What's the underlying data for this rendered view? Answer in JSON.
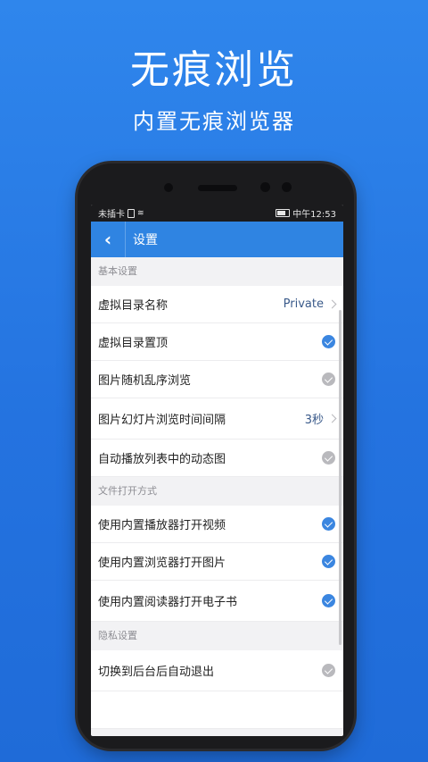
{
  "hero": {
    "title": "无痕浏览",
    "subtitle": "内置无痕浏览器"
  },
  "status_bar": {
    "carrier": "未插卡",
    "time": "中午12:53"
  },
  "app_bar": {
    "title": "设置",
    "back_glyph": "‹"
  },
  "sections": [
    {
      "header": "基本设置",
      "items": [
        {
          "label": "虚拟目录名称",
          "value": "Private",
          "control": "chevron"
        },
        {
          "label": "虚拟目录置顶",
          "control": "check",
          "checked": true
        },
        {
          "label": "图片随机乱序浏览",
          "control": "check",
          "checked": false
        },
        {
          "label": "图片幻灯片浏览时间间隔",
          "value": "3秒",
          "control": "chevron"
        },
        {
          "label": "自动播放列表中的动态图",
          "control": "check",
          "checked": false
        }
      ]
    },
    {
      "header": "文件打开方式",
      "items": [
        {
          "label": "使用内置播放器打开视频",
          "control": "check",
          "checked": true
        },
        {
          "label": "使用内置浏览器打开图片",
          "control": "check",
          "checked": true
        },
        {
          "label": "使用内置阅读器打开电子书",
          "control": "check",
          "checked": true
        }
      ]
    },
    {
      "header": "隐私设置",
      "items": [
        {
          "label": "切换到后台后自动退出",
          "control": "check",
          "checked": false
        }
      ]
    }
  ],
  "colors": {
    "accent": "#2f84e2",
    "check_on": "#3b86e0",
    "check_off": "#b9b9bd",
    "background": "#2473e0"
  }
}
